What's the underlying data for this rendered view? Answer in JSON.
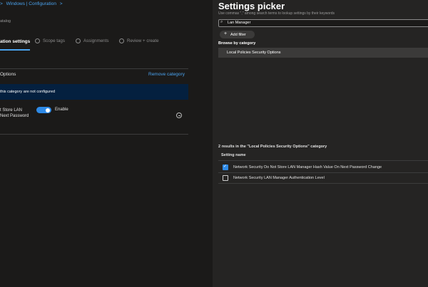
{
  "left": {
    "breadcrumb": {
      "prefix": ">",
      "link": "Windows | Configuration",
      "suffix": ">"
    },
    "subtitle": "atalog",
    "steps": [
      {
        "label": "ation settings",
        "active": true
      },
      {
        "number": "2",
        "label": "Scope tags"
      },
      {
        "number": "3",
        "label": "Assignments"
      },
      {
        "number": "4",
        "label": "Review + create"
      }
    ],
    "category": {
      "title": "Options",
      "remove_label": "Remove category",
      "banner_text": "this category are not configured"
    },
    "setting": {
      "label_line1": "t Store LAN",
      "label_line2": "Next Password",
      "toggle_label": "Enable",
      "toggle_on": true,
      "icons": {
        "toggle": "toggle-switch",
        "remove": "minus-circle-icon"
      }
    }
  },
  "picker": {
    "title": "Settings picker",
    "hint": "Use commas \",\" among search terms to lookup settings by their keywords",
    "search_value": "Lan Manager",
    "add_filter_label": "Add filter",
    "browse_label": "Browse by category",
    "category_selected": "Local Policies Security Options",
    "results_caption": "2 results in the \"Local Policies Security Options\" category",
    "column_header": "Setting name",
    "results": [
      {
        "name": "Network Security Do Not Store LAN Manager Hash Value On Next Password Change",
        "checked": true
      },
      {
        "name": "Network Security LAN Manager Authentication Level",
        "checked": false
      }
    ],
    "colors": {
      "accent": "#2e8ae6",
      "link": "#4aa3ef",
      "banner": "#04203f"
    }
  }
}
